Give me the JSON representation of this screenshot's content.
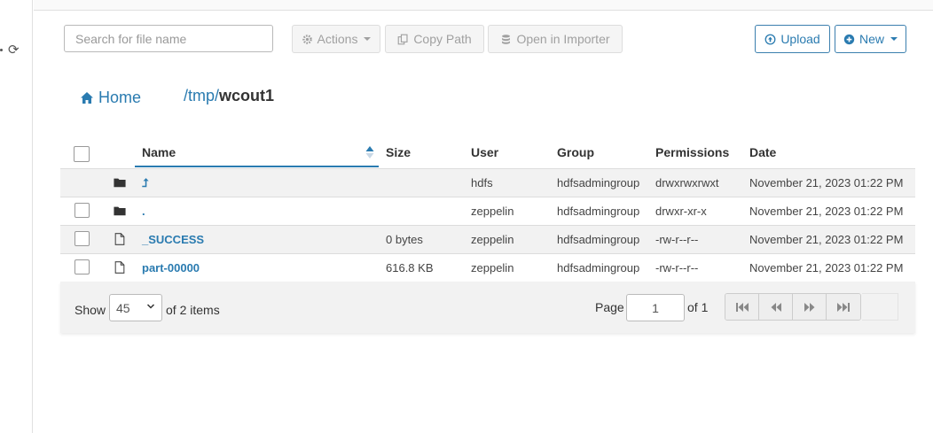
{
  "sidebar": {
    "refresh_icon": "refresh-icon"
  },
  "toolbar": {
    "search_placeholder": "Search for file name",
    "actions_label": "Actions",
    "copy_path_label": "Copy Path",
    "open_importer_label": "Open in Importer",
    "upload_label": "Upload",
    "new_label": "New"
  },
  "breadcrumb": {
    "home_label": "Home",
    "path_prefix": "/tmp/",
    "current": "wcout1"
  },
  "table": {
    "columns": [
      "Name",
      "Size",
      "User",
      "Group",
      "Permissions",
      "Date"
    ],
    "rows": [
      {
        "icon": "folder-icon",
        "name": "⮥",
        "size": "",
        "user": "hdfs",
        "group": "hdfsadmingroup",
        "permissions": "drwxrwxrwxt",
        "date": "November 21, 2023 01:22 PM"
      },
      {
        "icon": "folder-icon",
        "name": ".",
        "size": "",
        "user": "zeppelin",
        "group": "hdfsadmingroup",
        "permissions": "drwxr-xr-x",
        "date": "November 21, 2023 01:22 PM"
      },
      {
        "icon": "file-icon",
        "name": "_SUCCESS",
        "size": "0 bytes",
        "user": "zeppelin",
        "group": "hdfsadmingroup",
        "permissions": "-rw-r--r--",
        "date": "November 21, 2023 01:22 PM"
      },
      {
        "icon": "file-icon",
        "name": "part-00000",
        "size": "616.8 KB",
        "user": "zeppelin",
        "group": "hdfsadmingroup",
        "permissions": "-rw-r--r--",
        "date": "November 21, 2023 01:22 PM"
      }
    ]
  },
  "footer": {
    "show_label": "Show",
    "page_size": "45",
    "items_label": "of 2 items",
    "page_label": "Page",
    "page_value": "1",
    "of_label": "of 1"
  },
  "colors": {
    "accent": "#2a7bb0",
    "row_alt": "#f2f2f2",
    "border": "#dcdcdc"
  }
}
